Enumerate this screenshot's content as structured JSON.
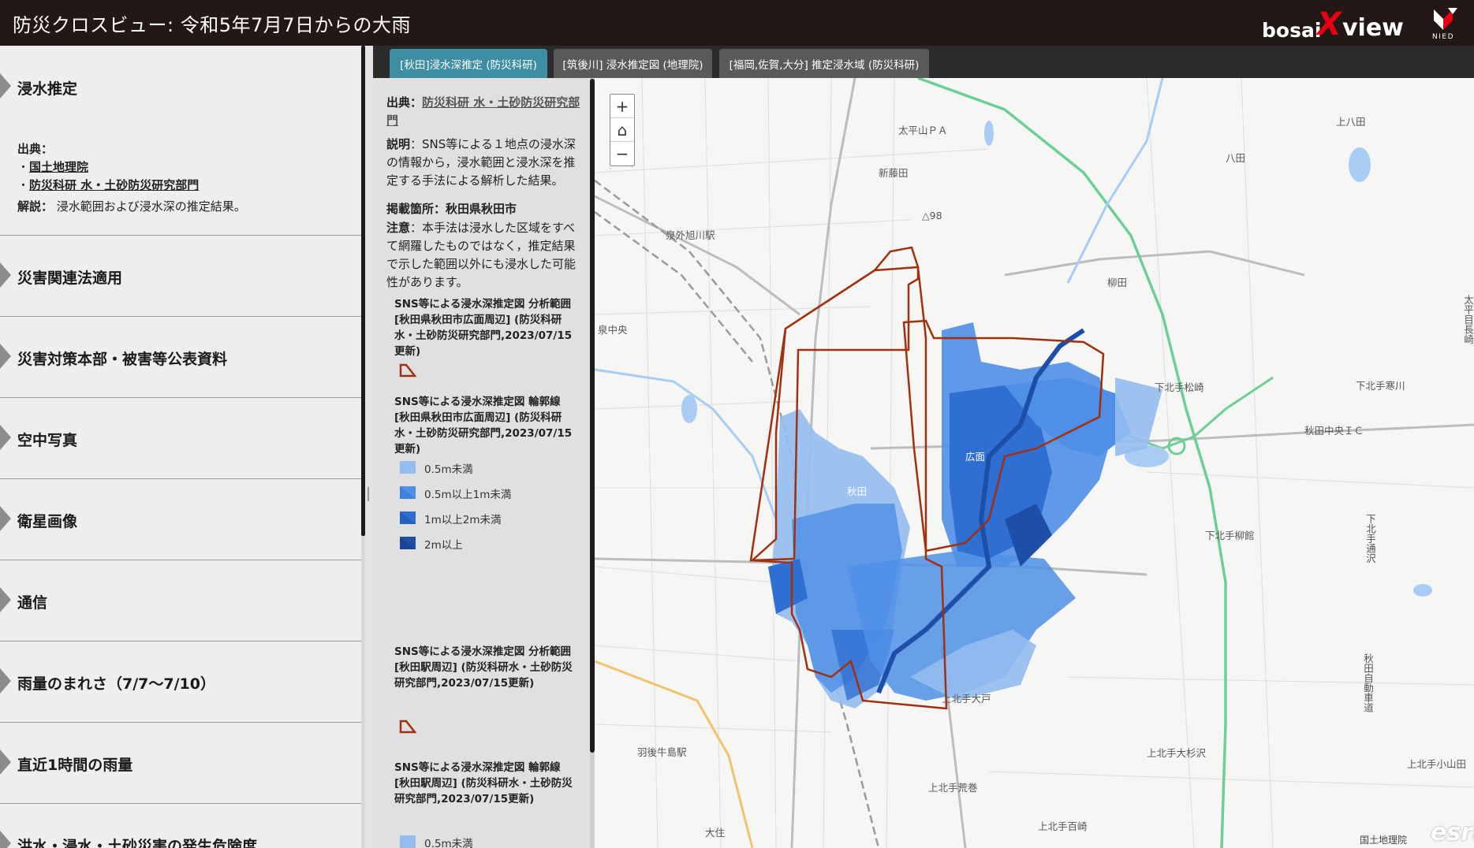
{
  "header": {
    "title": "防災クロスビュー: 令和5年7月7日からの大雨",
    "brand_left": "bosai",
    "brand_x": "X",
    "brand_right": "view",
    "org_logo_text": "NIED"
  },
  "sidebar": {
    "sections": [
      {
        "label": "浸水推定",
        "expanded": true
      },
      {
        "label": "災害関連法適用"
      },
      {
        "label": "災害対策本部・被害等公表資料"
      },
      {
        "label": "空中写真"
      },
      {
        "label": "衛星画像"
      },
      {
        "label": "通信"
      },
      {
        "label": "雨量のまれさ（7/7〜7/10）"
      },
      {
        "label": "直近1時間の雨量"
      },
      {
        "label": "洪水・浸水・土砂災害の発生危険度"
      }
    ],
    "source_heading": "出典：",
    "source_links": [
      "国土地理院",
      "防災科研 水・土砂防災研究部門"
    ],
    "bullet": "・",
    "explanation_label": "解説：",
    "explanation_text": "浸水範囲および浸水深の推定結果。"
  },
  "layer_tabs": [
    {
      "label": "[秋田]浸水深推定 (防災科研)",
      "active": true
    },
    {
      "label": "[筑後川] 浸水推定図 (地理院)",
      "active": false
    },
    {
      "label": "[福岡,佐賀,大分] 推定浸水域 (防災科研)",
      "active": false
    }
  ],
  "info_panel": {
    "source_label": "出典：",
    "source_link": "防災科研 水・土砂防災研究部門",
    "desc_label": "説明",
    "desc_text": "：SNS等による１地点の浸水深の情報から，浸水範囲と浸水深を推定する手法による解析した結果。",
    "place_label": "掲載箇所：秋田県秋田市",
    "note_label": "注意",
    "note_text": "：本手法は浸水した区域をすべて網羅したものではなく，推定結果で示した範囲以外にも浸水した可能性があります。",
    "layers": [
      {
        "title": "SNS等による浸水深推定図 分析範囲 [秋田県秋田市広面周辺] (防災科研水・土砂防災研究部門,2023/07/15更新)"
      },
      {
        "title": "SNS等による浸水深推定図 輪郭線 [秋田県秋田市広面周辺] (防災科研水・土砂防災研究部門,2023/07/15更新)"
      },
      {
        "title": "SNS等による浸水深推定図 分析範囲 [秋田駅周辺] (防災科研水・土砂防災研究部門,2023/07/15更新)"
      },
      {
        "title": "SNS等による浸水深推定図 輪郭線 [秋田駅周辺] (防災科研水・土砂防災研究部門,2023/07/15更新)"
      }
    ],
    "legend": [
      {
        "label": "0.5m未満",
        "color": "#93bdf0"
      },
      {
        "label": "0.5m以上1m未満",
        "color": "#4f8fe6"
      },
      {
        "label": "1m以上2m未満",
        "color": "#2f6fd2"
      },
      {
        "label": "2m以上",
        "color": "#1e4fa8"
      }
    ],
    "legend_partial": "0.5m未満"
  },
  "map": {
    "zoom_in": "+",
    "home": "⌂",
    "zoom_out": "−",
    "labels": {
      "taiheiyama_pa": "太平山ＰＡ",
      "kamihachida": "上八田",
      "hachida": "八田",
      "shinfujita": "新藤田",
      "izumisotoasahikawa": "泉外旭川駅",
      "elev98": "△98",
      "yanagida": "柳田",
      "izumichuo": "泉中央",
      "shimokitatematsuzaki": "下北手松崎",
      "shimokitatesamukawa": "下北手寒川",
      "akitachuo_ic": "秋田中央ＩＣ",
      "shimokitateyanagidate": "下北手柳館",
      "kamikitateoto": "上北手大戸",
      "ugousijima": "羽後牛島駅",
      "kamikitateosugisawa": "上北手大杉沢",
      "kamikitatekoyamada": "上北手小山田",
      "kamikitatearamaki": "上北手荒巻",
      "kamikitatehyakume": "上北手百崎",
      "daizumi": "大住",
      "taiheimeotanaga": "太平目長崎",
      "shimokitatetsusawa": "下北手通沢",
      "akita_expressway": "秋田自動車道",
      "akita_station_area": "秋田",
      "hirosomote": "広面",
      "attribution": "国土地理院",
      "powered_by": "esri"
    },
    "colors": {
      "flood_light": "#93bdf0",
      "flood_mid": "#4f8fe6",
      "flood_dark": "#2f6fd2",
      "outline": "#a0300f",
      "expressway": "#6ccf95",
      "river": "#1e4fa8"
    }
  }
}
